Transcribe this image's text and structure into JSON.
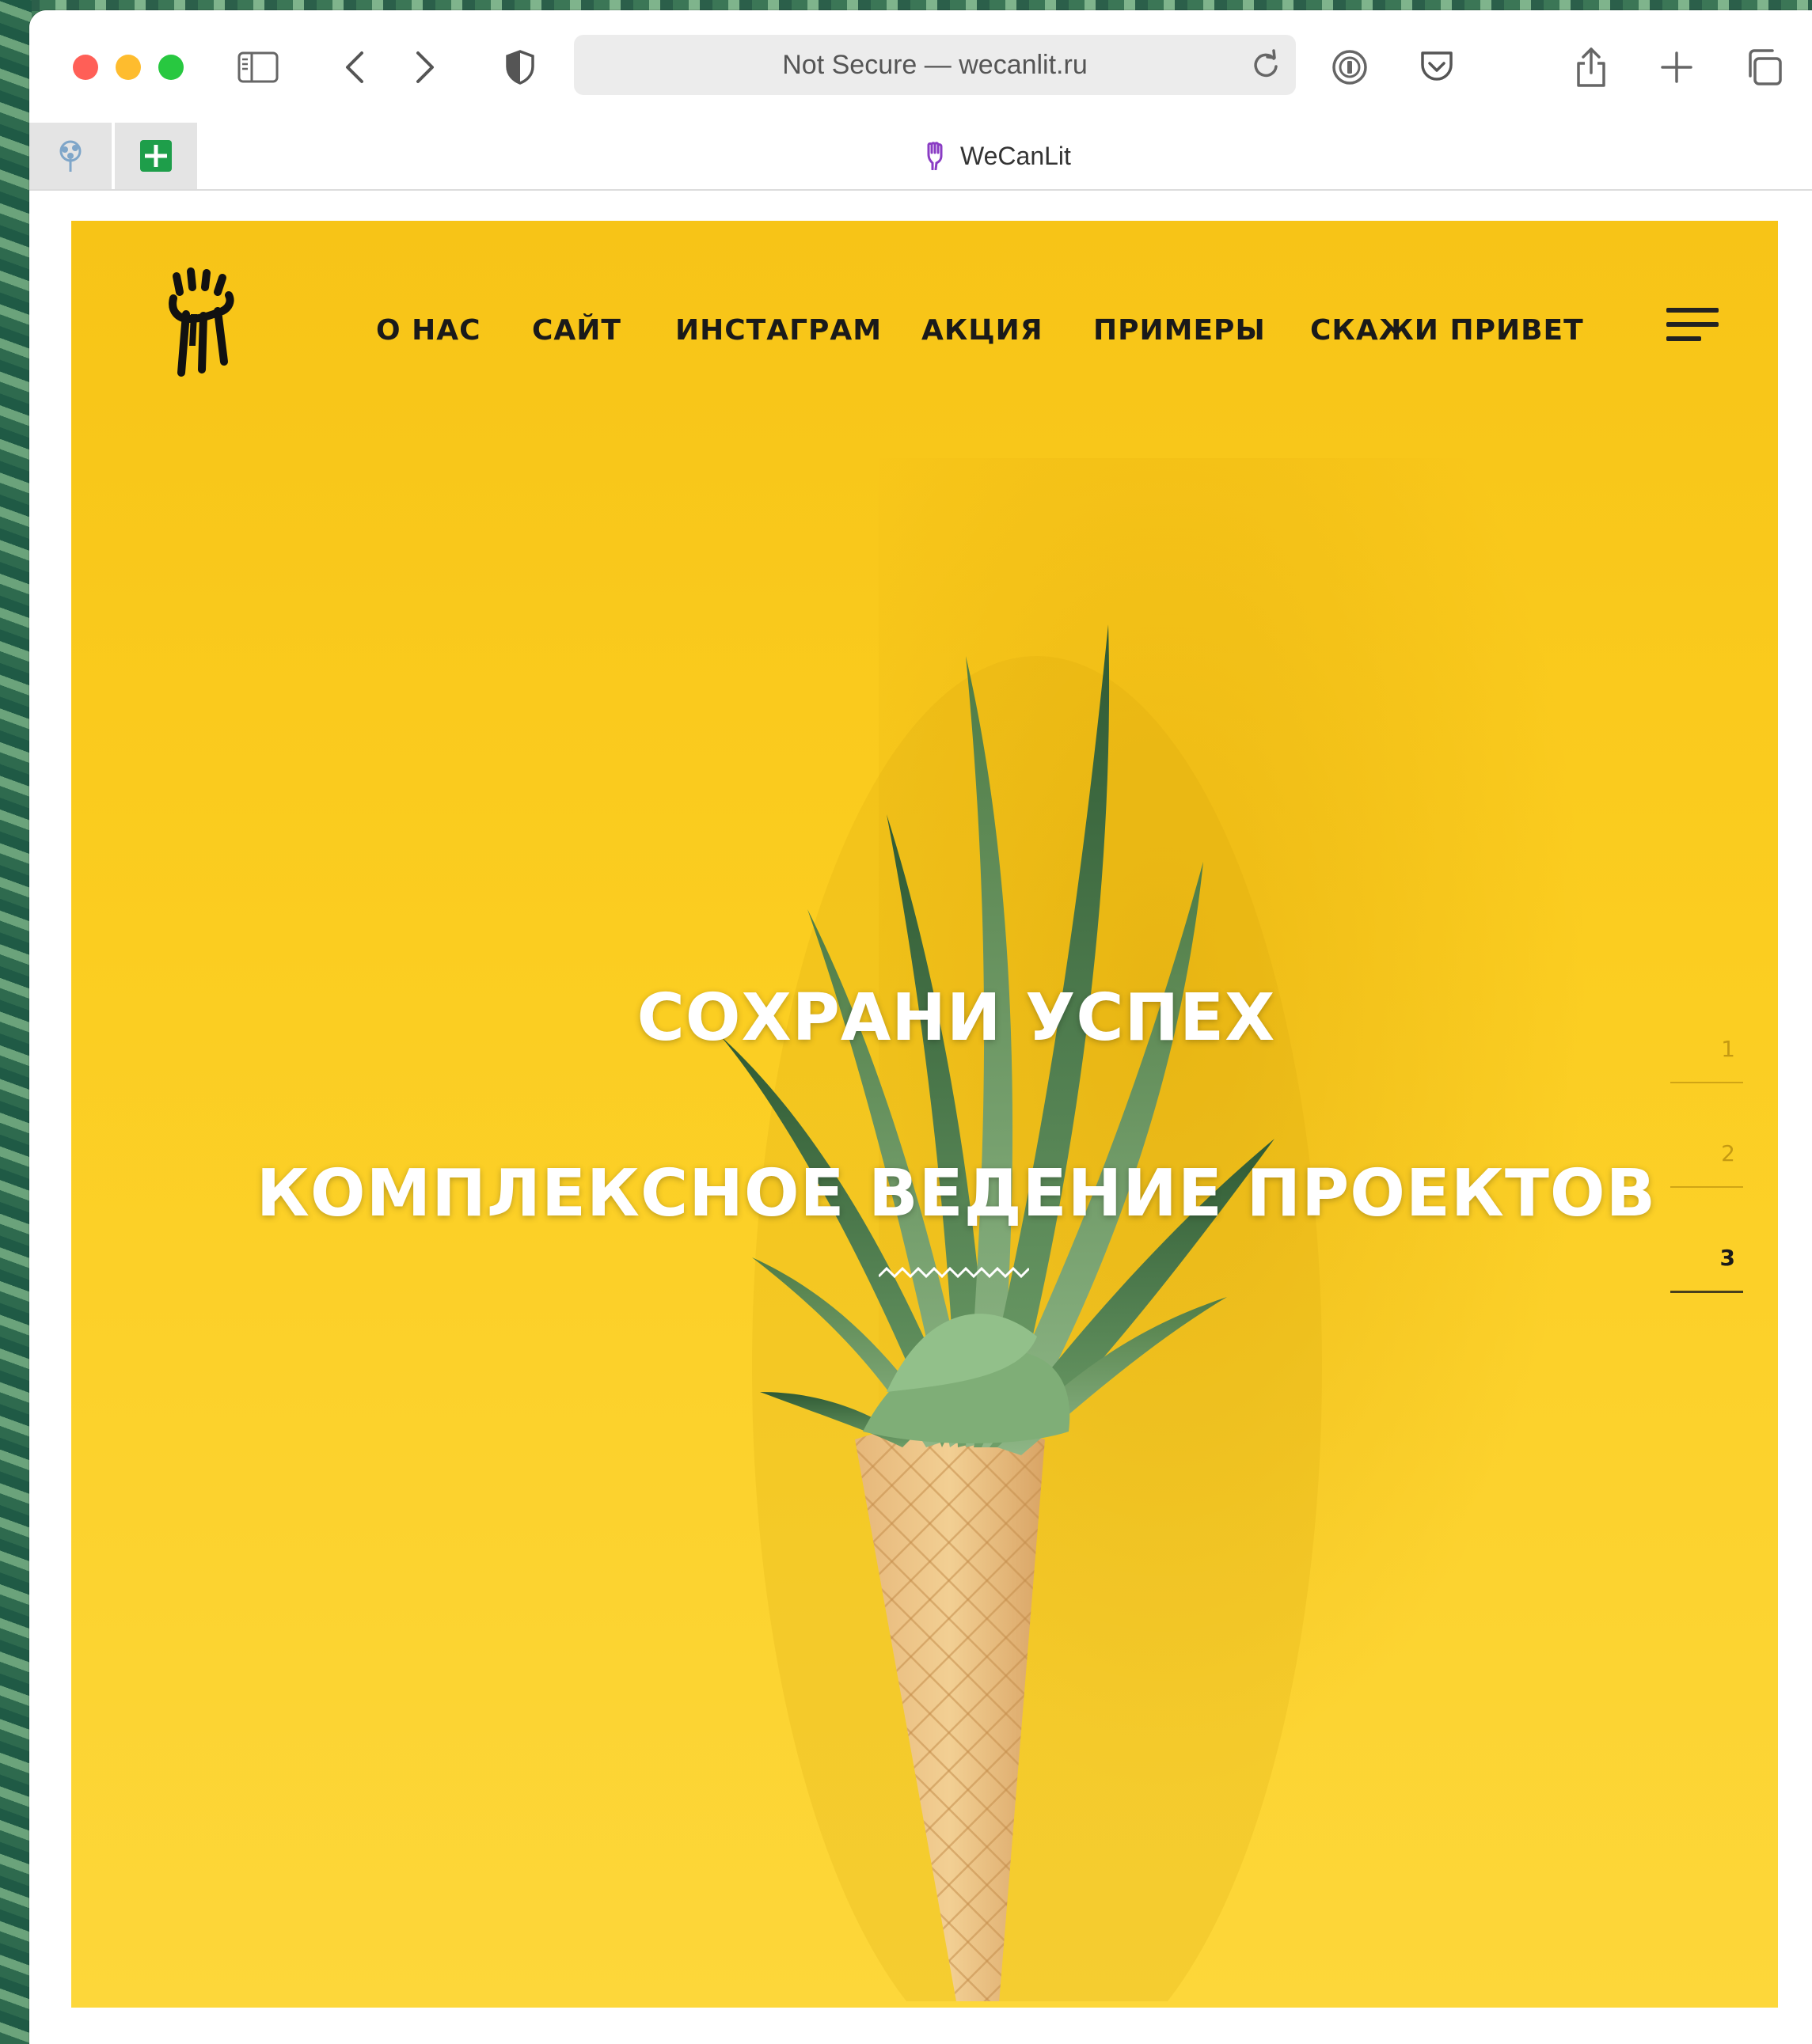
{
  "browser": {
    "address_text": "Not Secure — wecanlit.ru",
    "tab_title": "WeCanLit",
    "icons": {
      "sidebar": "sidebar-icon",
      "back": "chevron-left-icon",
      "forward": "chevron-right-icon",
      "privacy": "shield-icon",
      "reload": "reload-icon",
      "password": "password-manager-icon",
      "pocket": "pocket-icon",
      "share": "share-icon",
      "new_tab": "plus-icon",
      "tabs_overview": "tabs-overview-icon"
    },
    "colors": {
      "close": "#ff5f57",
      "minimize": "#febc2e",
      "zoom": "#28c840"
    }
  },
  "site": {
    "nav": [
      {
        "label": "О НАС"
      },
      {
        "label": "САЙТ"
      },
      {
        "label": "ИНСТАГРАМ"
      },
      {
        "label": "АКЦИЯ"
      },
      {
        "label": "ПРИМЕРЫ"
      },
      {
        "label": "СКАЖИ ПРИВЕТ"
      }
    ],
    "hero": {
      "title_1": "СОХРАНИ УСПЕХ",
      "title_2": "КОМПЛЕКСНОЕ ВЕДЕНИЕ ПРОЕКТОВ"
    },
    "slides": [
      {
        "label": "1"
      },
      {
        "label": "2"
      },
      {
        "label": "3"
      }
    ],
    "active_slide": 3,
    "colors": {
      "background": "#f7c417",
      "text": "#1a1a1a",
      "hero_text": "#ffffff"
    }
  }
}
